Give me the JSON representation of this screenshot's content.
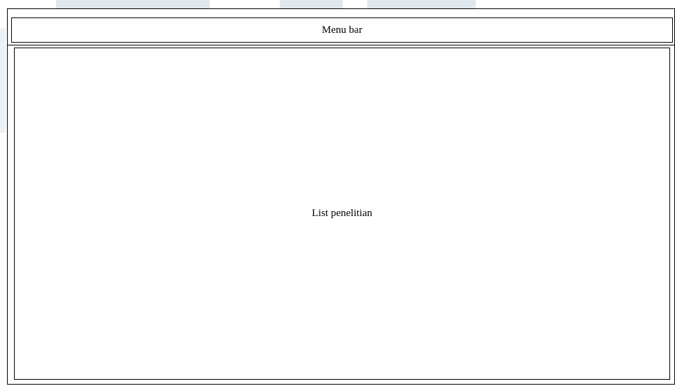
{
  "menu_bar": {
    "label": "Menu bar"
  },
  "content": {
    "label": "List penelitian"
  }
}
